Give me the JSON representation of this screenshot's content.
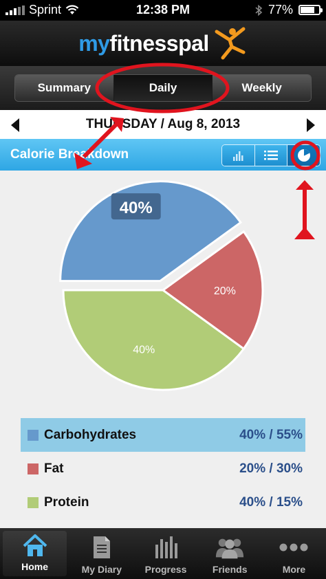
{
  "status": {
    "carrier": "Sprint",
    "time": "12:38 PM",
    "battery": "77%",
    "battery_level": 0.77
  },
  "app": {
    "logo_part1": "my",
    "logo_part2": "fitnesspal"
  },
  "tabs": [
    {
      "label": "Summary",
      "active": false
    },
    {
      "label": "Daily",
      "active": true
    },
    {
      "label": "Weekly",
      "active": false
    }
  ],
  "date": {
    "label": "THURSDAY / Aug 8, 2013"
  },
  "section": {
    "title": "Calorie Breakdown",
    "views": [
      "bar-chart-icon",
      "list-icon",
      "pie-chart-icon"
    ],
    "active_view": "pie-chart-icon"
  },
  "chart_data": {
    "type": "pie",
    "slices": [
      {
        "name": "Carbohydrates",
        "value": 40,
        "label": "40%",
        "color": "#6699cc"
      },
      {
        "name": "Fat",
        "value": 20,
        "label": "20%",
        "color": "#cc6666"
      },
      {
        "name": "Protein",
        "value": 40,
        "label": "40%",
        "color": "#b1cc77"
      }
    ],
    "selected": "Carbohydrates"
  },
  "legend": [
    {
      "name": "Carbohydrates",
      "value": "40% / 55%",
      "color": "#6699cc",
      "selected": true
    },
    {
      "name": "Fat",
      "value": "20% / 30%",
      "color": "#cc6666",
      "selected": false
    },
    {
      "name": "Protein",
      "value": "40% / 15%",
      "color": "#b1cc77",
      "selected": false
    }
  ],
  "nav": [
    {
      "label": "Home",
      "icon": "home-icon",
      "active": true
    },
    {
      "label": "My Diary",
      "icon": "diary-icon",
      "active": false
    },
    {
      "label": "Progress",
      "icon": "progress-icon",
      "active": false
    },
    {
      "label": "Friends",
      "icon": "friends-icon",
      "active": false
    },
    {
      "label": "More",
      "icon": "more-icon",
      "active": false
    }
  ],
  "colors": {
    "accent": "#2ea6e4",
    "annotation": "#e0141e"
  }
}
